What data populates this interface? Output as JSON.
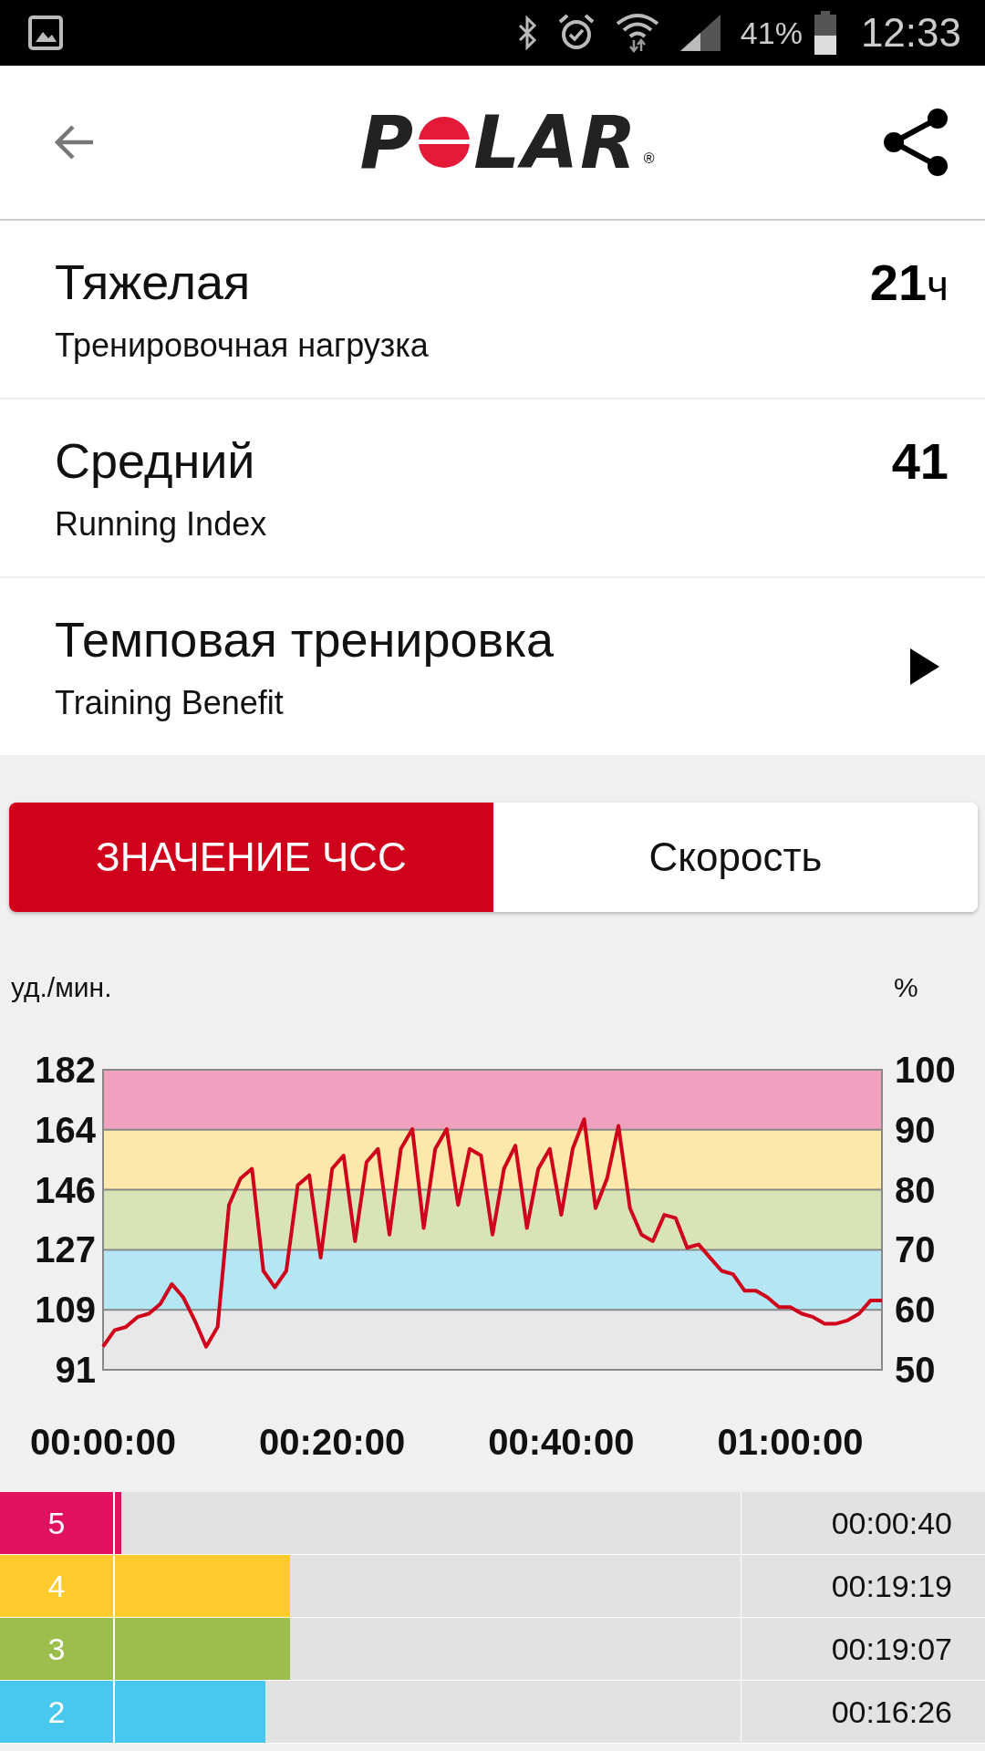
{
  "status_bar": {
    "battery": "41%",
    "time": "12:33"
  },
  "header": {
    "logo": {
      "before": "P",
      "after": "LAR",
      "mark": "®"
    }
  },
  "metrics": [
    {
      "kind": "value",
      "title": "Тяжелая",
      "subtitle": "Тренировочная нагрузка",
      "value": "21",
      "unit": "ч"
    },
    {
      "kind": "value",
      "title": "Средний",
      "subtitle": "Running Index",
      "value": "41"
    },
    {
      "kind": "link",
      "title": "Темповая тренировка",
      "subtitle": "Training Benefit"
    }
  ],
  "tabs": [
    {
      "label": "ЗНАЧЕНИЕ ЧСС",
      "selected": true
    },
    {
      "label": "Скорость",
      "selected": false
    }
  ],
  "chart": {
    "y2label": "%",
    "chart_data": {
      "type": "line",
      "ylabel": "уд./мин.",
      "grid": true,
      "xlim": [
        0,
        68
      ],
      "ylim": [
        91,
        182
      ],
      "yticks": [
        91,
        109,
        127,
        146,
        164,
        182
      ],
      "y2ticks": [
        "100",
        "90",
        "80",
        "70",
        "60",
        "50"
      ],
      "xticks": [
        {
          "value": 0,
          "label": "00:00:00"
        },
        {
          "value": 20,
          "label": "00:20:00"
        },
        {
          "value": 40,
          "label": "00:40:00"
        },
        {
          "value": 60,
          "label": "01:00:00"
        }
      ],
      "x": [
        0,
        1,
        2,
        3,
        4,
        5,
        6,
        7,
        8,
        9,
        10,
        11,
        12,
        13,
        14,
        15,
        16,
        17,
        18,
        19,
        20,
        21,
        22,
        23,
        24,
        25,
        26,
        27,
        28,
        29,
        30,
        31,
        32,
        33,
        34,
        35,
        36,
        37,
        38,
        39,
        40,
        41,
        42,
        43,
        44,
        45,
        46,
        47,
        48,
        49,
        50,
        51,
        52,
        53,
        54,
        55,
        56,
        57,
        58,
        59,
        60,
        61,
        62,
        63,
        64,
        65,
        66,
        67,
        68
      ],
      "series": [
        {
          "color": "#d0021b",
          "values": [
            98,
            103,
            104,
            107,
            108,
            111,
            117,
            113,
            106,
            98,
            104,
            141,
            149,
            152,
            121,
            116,
            121,
            147,
            150,
            125,
            152,
            156,
            130,
            154,
            158,
            132,
            158,
            164,
            134,
            158,
            164,
            141,
            158,
            156,
            132,
            152,
            159,
            134,
            152,
            158,
            138,
            158,
            167,
            140,
            149,
            165,
            140,
            132,
            130,
            138,
            137,
            128,
            129,
            125,
            121,
            120,
            115,
            115,
            113,
            110,
            110,
            108,
            107,
            105,
            105,
            106,
            108,
            112,
            112
          ]
        }
      ]
    }
  },
  "zones": [
    {
      "number": "5",
      "color": "#e0115f",
      "time": "00:00:40"
    },
    {
      "number": "4",
      "color": "#ffca2c",
      "level": 0.28,
      "time": "00:19:19"
    },
    {
      "number": "3",
      "color": "#9cbe4c",
      "level": 0.28,
      "time": "00:19:07"
    },
    {
      "number": "2",
      "color": "#48c8ee",
      "level": 0.24,
      "time": "00:16:26"
    }
  ]
}
